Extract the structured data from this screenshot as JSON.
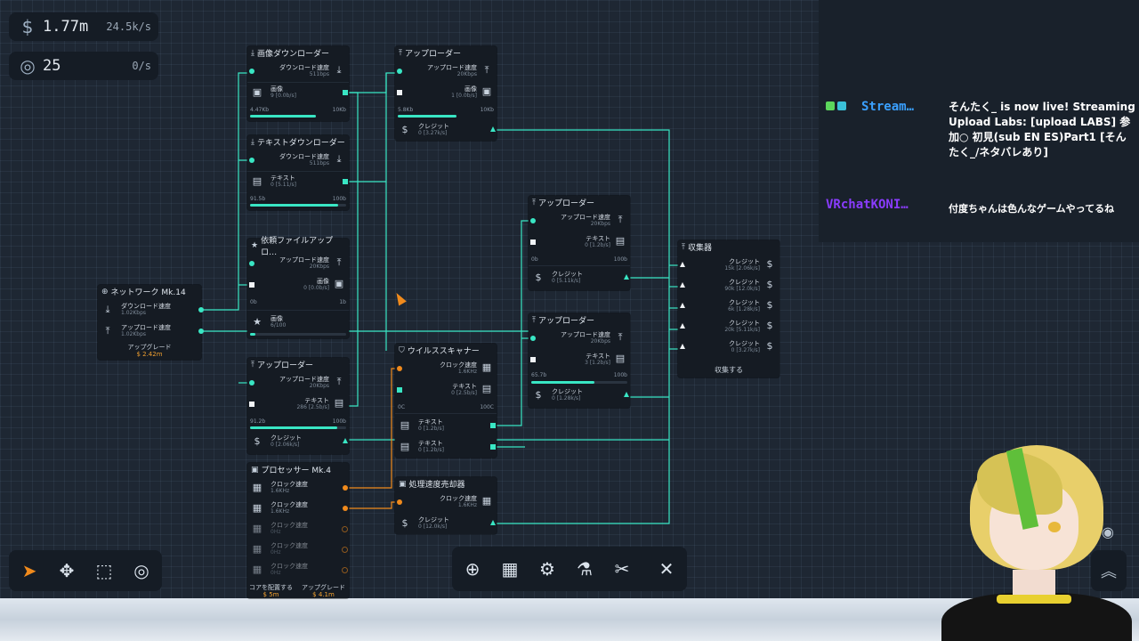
{
  "resources": {
    "money_icon": "dollar-icon",
    "money_value": "1.77m",
    "money_rate": "24.5k/s",
    "research_icon": "target-icon",
    "research_value": "25",
    "research_rate": "0/s"
  },
  "network": {
    "title": "ネットワーク Mk.14",
    "rows": [
      {
        "label": "ダウンロード速度",
        "sub": "1.02Kbps"
      },
      {
        "label": "アップロード速度",
        "sub": "1.02Kbps"
      }
    ],
    "upgrade": "アップグレード",
    "upgrade_cost": "$ 2.42m"
  },
  "img_dl": {
    "title": "画像ダウンローダー",
    "row1": "ダウンロード速度",
    "row1sub": "511bps",
    "row2": "画像",
    "row2sub": "9 [0.0b/s]",
    "min": "4.47Kb",
    "max": "10Kb",
    "progress": 0.65
  },
  "txt_dl": {
    "title": "テキストダウンローダー",
    "row1": "ダウンロード速度",
    "row1sub": "511bps",
    "row2": "テキスト",
    "row2sub": "0 [5.11/s]",
    "min": "91.5b",
    "max": "100b",
    "progress": 0.92
  },
  "req": {
    "title": "依頼ファイルアップロ…",
    "row1": "アップロード速度",
    "row1sub": "20Kbps",
    "row2": "画像",
    "row2sub": "0 [0.0b/s]",
    "min": "0b",
    "max": "1b",
    "row3": "画像",
    "row3sub": "6/100",
    "progress": 0.06
  },
  "up_left": {
    "title": "アップローダー",
    "row1": "アップロード速度",
    "row1sub": "20Kbps",
    "row2": "テキスト",
    "row2sub": "286 [2.5b/s]",
    "min": "91.2b",
    "max": "100b",
    "row3": "クレジット",
    "row3sub": "0 [2.06k/s]",
    "progress": 0.91
  },
  "cpu": {
    "title": "プロセッサー Mk.4",
    "rows": [
      {
        "label": "クロック速度",
        "sub": "1.6KHz"
      },
      {
        "label": "クロック速度",
        "sub": "1.6KHz"
      },
      {
        "label": "クロック速度",
        "sub": "0Hz"
      },
      {
        "label": "クロック速度",
        "sub": "0Hz"
      },
      {
        "label": "クロック速度",
        "sub": "0Hz"
      }
    ],
    "assign": "コアを配置する",
    "upgrade": "アップグレード",
    "assign_cost": "$ 5m",
    "upgrade_cost": "$ 4.1m"
  },
  "up_top": {
    "title": "アップローダー",
    "row1": "アップロード速度",
    "row1sub": "20Kbps",
    "row2": "画像",
    "row2sub": "1 [0.0b/s]",
    "min": "5.8Kb",
    "max": "10Kb",
    "row3": "クレジット",
    "row3sub": "0 [3.27k/s]",
    "progress": 0.58
  },
  "virus": {
    "title": "ウイルススキャナー",
    "row1": "クロック速度",
    "row1sub": "1.6KHz",
    "row2": "テキスト",
    "row2sub": "0 [2.5b/s]",
    "min": "0C",
    "max": "100C",
    "row3": "テキスト",
    "row3sub": "0 [1.2b/s]",
    "row4": "テキスト",
    "row4sub": "0 [1.2b/s]",
    "progress": 0.0
  },
  "seller": {
    "title": "処理速度売却器",
    "row1": "クロック速度",
    "row1sub": "1.6KHz",
    "row2": "クレジット",
    "row2sub": "0 [12.0k/s]"
  },
  "up_mid1": {
    "title": "アップローダー",
    "row1": "アップロード速度",
    "row1sub": "20Kbps",
    "row2": "テキスト",
    "row2sub": "0 [1.2b/s]",
    "min": "0b",
    "max": "100b",
    "row3": "クレジット",
    "row3sub": "0 [5.11k/s]",
    "progress": 0.0
  },
  "up_mid2": {
    "title": "アップローダー",
    "row1": "アップロード速度",
    "row1sub": "20Kbps",
    "row2": "テキスト",
    "row2sub": "3 [1.2b/s]",
    "min": "65.7b",
    "max": "100b",
    "row3": "クレジット",
    "row3sub": "0 [1.28k/s]",
    "progress": 0.66
  },
  "collector": {
    "title": "収集器",
    "rows": [
      {
        "label": "クレジット",
        "sub": "15k [2.06k/s]"
      },
      {
        "label": "クレジット",
        "sub": "90k [12.0k/s]"
      },
      {
        "label": "クレジット",
        "sub": "6k [1.28k/s]"
      },
      {
        "label": "クレジット",
        "sub": "20k [5.11k/s]"
      },
      {
        "label": "クレジット",
        "sub": "0 [3.27k/s]"
      }
    ],
    "collect": "収集する"
  },
  "chat": {
    "msg1_name": "Stream…",
    "msg1_text": "そんたく_ is now live! Streaming Upload Labs: [upload LABS] 参加○ 初見(sub EN ES)Part1 [そんたく_/ネタバレあり]",
    "msg2_name": "VRchatKONI…",
    "msg2_text": "付度ちゃんは色んなゲームやってるね"
  },
  "colors": {
    "accent": "#39e6c4",
    "orange": "#f08a1c",
    "panel": "#151b23"
  }
}
